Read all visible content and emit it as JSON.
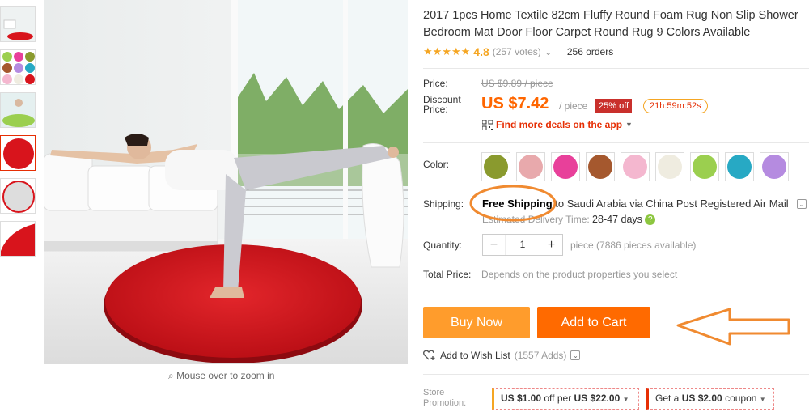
{
  "product": {
    "title": "2017 1pcs Home Textile 82cm Fluffy Round Foam Rug Non Slip Shower Bedroom Mat Door Floor Carpet Round Rug 9 Colors Available",
    "stars": "★★★★★",
    "rating": "4.8",
    "votes": "(257 votes)",
    "orders": "256 orders"
  },
  "gallery": {
    "zoom_hint": "Mouse over to zoom in"
  },
  "price": {
    "label": "Price:",
    "original": "US $9.89 / piece",
    "discount_label_1": "Discount",
    "discount_label_2": "Price:",
    "current": "US $7.42",
    "unit": "/ piece",
    "off": "25% off",
    "timer": "21h:59m:52s",
    "deals_link": "Find more deals on the app"
  },
  "color": {
    "label": "Color:",
    "swatches": [
      "#8a9a2e",
      "#e8a9ac",
      "#e8409a",
      "#a5582e",
      "#f4b7cf",
      "#efece0",
      "#9bcf4f",
      "#27a9c4",
      "#b58be0"
    ]
  },
  "shipping": {
    "label": "Shipping:",
    "method": "Free Shipping",
    "destination": " to Saudi Arabia via China Post Registered Air Mail",
    "delivery_label": "Estimated Delivery Time:",
    "delivery_days": "28-47 days"
  },
  "quantity": {
    "label": "Quantity:",
    "minus": "−",
    "value": "1",
    "plus": "+",
    "available": "piece (7886 pieces available)"
  },
  "total": {
    "label": "Total Price:",
    "value": "Depends on the product properties you select"
  },
  "actions": {
    "buy_now": "Buy Now",
    "add_to_cart": "Add to Cart",
    "wishlist": "Add to Wish List",
    "wishlist_count": "(1557 Adds)"
  },
  "store_promotion": {
    "label_1": "Store",
    "label_2": "Promotion:",
    "coupon1_amount": "US $1.00",
    "coupon1_rest": " off per ",
    "coupon1_min": "US $22.00",
    "coupon2_pre": "Get a ",
    "coupon2_amount": "US $2.00",
    "coupon2_post": " coupon"
  },
  "colors": {
    "accent": "#ff6a00",
    "buy_now": "#ff9c2c",
    "annotation": "#f08a30",
    "rug_red": "#d8141c"
  }
}
